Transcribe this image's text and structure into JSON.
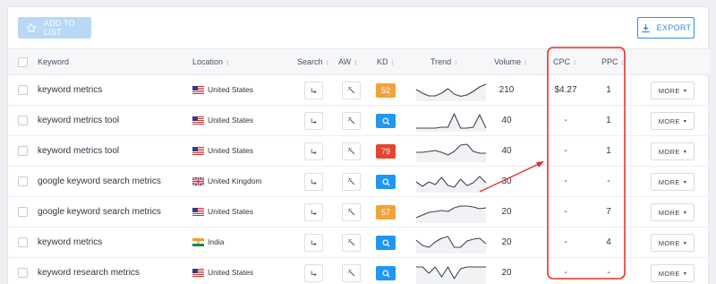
{
  "toolbar": {
    "add_label": "ADD TO LIST",
    "export_label": "EXPORT"
  },
  "columns": {
    "keyword": "Keyword",
    "location": "Location",
    "search": "Search",
    "aw": "AW",
    "kd": "KD",
    "trend": "Trend",
    "volume": "Volume",
    "cpc": "CPC",
    "ppc": "PPC"
  },
  "rows": [
    {
      "keyword": "keyword metrics",
      "location": "United States",
      "flag": "us",
      "kd": "52",
      "kd_color": "#f5a13b",
      "volume": "210",
      "cpc": "$4.27",
      "ppc": "1",
      "more": "MORE",
      "trend": [
        0.55,
        0.35,
        0.2,
        0.2,
        0.35,
        0.6,
        0.3,
        0.18,
        0.25,
        0.45,
        0.7,
        0.85
      ]
    },
    {
      "keyword": "keyword metrics tool",
      "location": "United States",
      "flag": "us",
      "kd": "",
      "kd_color": "#2196f3",
      "kd_icon": "search-icon",
      "volume": "40",
      "cpc": "-",
      "ppc": "1",
      "more": "MORE",
      "trend": [
        0.1,
        0.1,
        0.1,
        0.1,
        0.15,
        0.15,
        0.9,
        0.1,
        0.1,
        0.15,
        0.85,
        0.1
      ]
    },
    {
      "keyword": "keyword metrics tool",
      "location": "United States",
      "flag": "us",
      "kd": "79",
      "kd_color": "#e8442d",
      "volume": "40",
      "cpc": "-",
      "ppc": "1",
      "more": "MORE",
      "trend": [
        0.45,
        0.45,
        0.5,
        0.55,
        0.45,
        0.3,
        0.5,
        0.85,
        0.9,
        0.5,
        0.4,
        0.4
      ]
    },
    {
      "keyword": "google keyword search metrics",
      "location": "United Kingdom",
      "flag": "uk",
      "kd": "",
      "kd_color": "#2196f3",
      "kd_icon": "search-icon",
      "volume": "30",
      "cpc": "-",
      "ppc": "-",
      "more": "MORE",
      "trend": [
        0.5,
        0.25,
        0.5,
        0.35,
        0.75,
        0.3,
        0.2,
        0.65,
        0.3,
        0.45,
        0.8,
        0.45
      ]
    },
    {
      "keyword": "google keyword search metrics",
      "location": "United States",
      "flag": "us",
      "kd": "57",
      "kd_color": "#f5a13b",
      "volume": "20",
      "cpc": "-",
      "ppc": "7",
      "more": "MORE",
      "trend": [
        0.2,
        0.35,
        0.5,
        0.55,
        0.6,
        0.55,
        0.75,
        0.85,
        0.85,
        0.8,
        0.7,
        0.75
      ]
    },
    {
      "keyword": "keyword metrics",
      "location": "India",
      "flag": "in",
      "kd": "",
      "kd_color": "#2196f3",
      "kd_icon": "search-icon",
      "volume": "20",
      "cpc": "-",
      "ppc": "4",
      "more": "MORE",
      "trend": [
        0.65,
        0.35,
        0.25,
        0.55,
        0.75,
        0.85,
        0.25,
        0.25,
        0.6,
        0.7,
        0.75,
        0.45
      ]
    },
    {
      "keyword": "keyword research metrics",
      "location": "United States",
      "flag": "us",
      "kd": "",
      "kd_color": "#2196f3",
      "kd_icon": "search-icon",
      "volume": "20",
      "cpc": "-",
      "ppc": "-",
      "more": "MORE",
      "trend": [
        0.85,
        0.85,
        0.5,
        0.85,
        0.3,
        0.85,
        0.2,
        0.75,
        0.85,
        0.85,
        0.85,
        0.85
      ]
    }
  ],
  "annotation": {
    "highlight_color": "#e8312a"
  }
}
